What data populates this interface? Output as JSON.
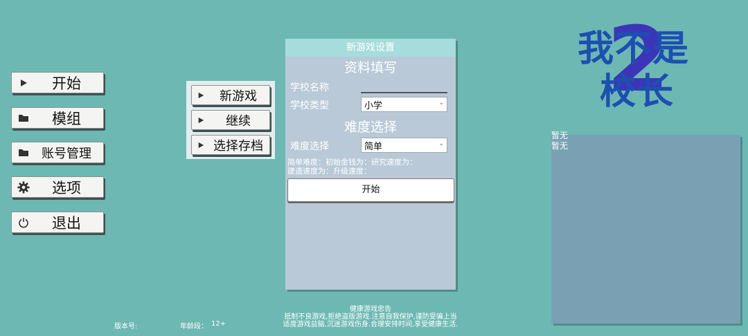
{
  "main_menu": {
    "start": "开始",
    "mods": "模组",
    "account": "账号管理",
    "options": "选项",
    "quit": "退出"
  },
  "submenu": {
    "new_game": "新游戏",
    "continue": "继续",
    "load_save": "选择存档"
  },
  "new_game_panel": {
    "header": "新游戏设置",
    "section_info": "资料填写",
    "school_name_label": "学校名称",
    "school_name_value": "",
    "school_type_label": "学校类型",
    "school_type_value": "小学",
    "section_difficulty": "难度选择",
    "difficulty_label": "难度选择",
    "difficulty_value": "简单",
    "difficulty_desc_line1": "简单难度：初始金钱为：研究速度为：",
    "difficulty_desc_line2": "建造速度为：升级速度：",
    "start_button": "开始"
  },
  "logo": {
    "line1": "我不是",
    "line2": "校长",
    "numeral": "2"
  },
  "news": {
    "line1": "暂无",
    "line2": "暂无"
  },
  "footer": {
    "version_label": "版本号:",
    "age_label": "年龄段：",
    "age_value": "12+",
    "health_title": "健康游戏忠告",
    "health_line1": "抵制不良游戏,拒绝盗版游戏.注意自我保护,谨防受骗上当",
    "health_line2": "适度游戏益脑,沉迷游戏伤身.合理安排时间,享受健康生活."
  },
  "icons": {
    "start": "play-icon",
    "mods": "folder-icon",
    "account": "folder-icon",
    "options": "gear-icon",
    "quit": "power-icon"
  },
  "colors": {
    "background": "#6db8b3",
    "panel": "#b9c9d8",
    "panel_header": "#a6dcdc",
    "logo_text": "#1d4fb0",
    "logo_numeral": "#3c35b7",
    "news_box": "#7aa1b3"
  }
}
